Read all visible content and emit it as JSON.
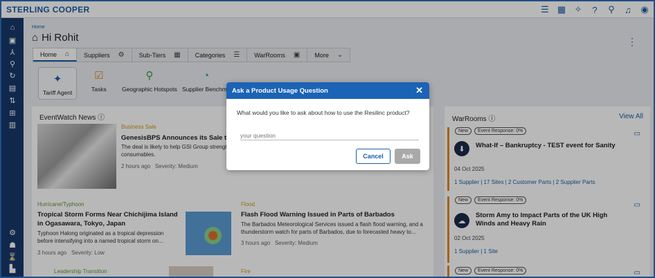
{
  "app": {
    "brand": "STERLING COOPER"
  },
  "topbar_icons": [
    "list-icon",
    "grid-icon",
    "sparkle-icon",
    "help-icon",
    "search-icon",
    "bell-icon",
    "user-icon"
  ],
  "sidebar_icons": [
    "home-icon",
    "calendar-icon",
    "network-icon",
    "search-icon",
    "refresh-icon",
    "clipboard-icon",
    "sliders-icon",
    "apps-icon",
    "building-icon",
    "settings-icon",
    "people-icon",
    "hourglass-icon",
    "chart-icon"
  ],
  "page": {
    "breadcrumb": "Home",
    "greeting": "Hi Rohit"
  },
  "tabs": [
    {
      "label": "Home",
      "icon": "⌂"
    },
    {
      "label": "Suppliers",
      "icon": "⚙"
    },
    {
      "label": "Sub-Tiers",
      "icon": "▦"
    },
    {
      "label": "Categories",
      "icon": "☰"
    },
    {
      "label": "WarRooms",
      "icon": "▣"
    },
    {
      "label": "More",
      "icon": "⌄"
    }
  ],
  "shortcuts": [
    {
      "label": "Tariff Agent",
      "icon": "✦"
    },
    {
      "label": "Tasks",
      "icon": "☑"
    },
    {
      "label": "Geographic Hotspots",
      "icon": "⚲"
    },
    {
      "label": "Supplier Benchma",
      "icon": "◔"
    }
  ],
  "eventwatch": {
    "title": "EventWatch News",
    "items": [
      {
        "category": "Business Sale",
        "category_color": "#c99a1a",
        "title": "GenesisBPS Announces its Sale to G",
        "summary": "The deal is likely to help GSI Group strengt consumables.",
        "time": "2 hours ago",
        "severity": "Severity: Medium"
      },
      {
        "category": "Hurricane/Typhoon",
        "category_color": "#5a9a3c",
        "title": "Tropical Storm Forms Near Chichijima Island in Ogasawara, Tokyo, Japan",
        "summary": "Typhoon Halong originated as a tropical depression before intensifying into a named tropical storm on...",
        "time": "3 hours ago",
        "severity": "Severity: Low"
      },
      {
        "category": "Flood",
        "category_color": "#c99a1a",
        "title": "Flash Flood Warning Issued in Parts of Barbados",
        "summary": "The Barbados Meteorological Services issued a flash flood warning, and a thunderstorm watch for parts of Barbados, due to forecasted heavy to...",
        "time": "3 hours ago",
        "severity": "Severity: Medium"
      },
      {
        "category": "Leadership Transition",
        "category_color": "#5a9a3c"
      },
      {
        "category": "Fire",
        "category_color": "#c99a1a"
      }
    ]
  },
  "warrooms": {
    "title": "WarRooms",
    "view_all": "View All",
    "cards": [
      {
        "new": "New",
        "response": "Event Response: 0%",
        "title": "What-If – Bankruptcy - TEST event for Sanity",
        "date": "04 Oct 2025",
        "links": "1 Supplier | 17 Sites | 2 Customer Parts | 2 Supplier Parts"
      },
      {
        "new": "New",
        "response": "Event Response: 0%",
        "title": "Storm Amy to Impact Parts of the UK High Winds and Heavy Rain",
        "date": "02 Oct 2025",
        "links": "1 Supplier | 1 Site"
      },
      {
        "new": "New",
        "response": "Event Response: 0%"
      }
    ]
  },
  "modal": {
    "title": "Ask a Product Usage Question",
    "question": "What would you like to ask about how to use the Resilinc product?",
    "placeholder": "your question",
    "cancel": "Cancel",
    "ask": "Ask"
  }
}
